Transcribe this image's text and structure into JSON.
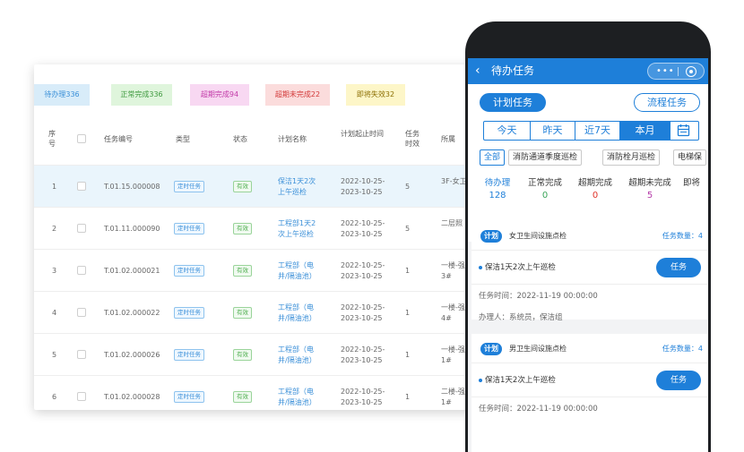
{
  "desktop": {
    "status_pills": [
      {
        "label": "待办理336",
        "bg": "#d8ecf9",
        "color": "#3a8fd8"
      },
      {
        "label": "正常完成336",
        "bg": "#dff5dc",
        "color": "#3f9a3f"
      },
      {
        "label": "超期完成94",
        "bg": "#f8d8f2",
        "color": "#c23aa8"
      },
      {
        "label": "超期未完成22",
        "bg": "#fbdcdc",
        "color": "#d33a3a"
      },
      {
        "label": "即将失效32",
        "bg": "#fdf6c8",
        "color": "#8a6d00"
      }
    ],
    "columns": {
      "index": "序号",
      "task_no": "任务编号",
      "type": "类型",
      "status": "状态",
      "plan_name": "计划名称",
      "plan_period": "计划起止时间",
      "task_validity": "任务时效",
      "belong": "所属"
    },
    "rows": [
      {
        "index": "1",
        "task_no": "T.01.15.000008",
        "type": "定时任务",
        "status": "有效",
        "plan_name_1": "保洁1天2次",
        "plan_name_2": "上午巡检",
        "period_1": "2022-10-25-",
        "period_2": "2023-10-25",
        "validity": "5",
        "belong_1": "3F-女卫",
        "belong_2": ""
      },
      {
        "index": "2",
        "task_no": "T.01.11.000090",
        "type": "定时任务",
        "status": "有效",
        "plan_name_1": "工程部1天2",
        "plan_name_2": "次上午巡检",
        "period_1": "2022-10-25-",
        "period_2": "2023-10-25",
        "validity": "5",
        "belong_1": "二层照",
        "belong_2": ""
      },
      {
        "index": "3",
        "task_no": "T.01.02.000021",
        "type": "定时任务",
        "status": "有效",
        "plan_name_1": "工程部（电",
        "plan_name_2": "井/隔油池）",
        "period_1": "2022-10-25-",
        "period_2": "2023-10-25",
        "validity": "1",
        "belong_1": "一楼-强",
        "belong_2": "3#"
      },
      {
        "index": "4",
        "task_no": "T.01.02.000022",
        "type": "定时任务",
        "status": "有效",
        "plan_name_1": "工程部（电",
        "plan_name_2": "井/隔油池）",
        "period_1": "2022-10-25-",
        "period_2": "2023-10-25",
        "validity": "1",
        "belong_1": "一楼-强",
        "belong_2": "4#"
      },
      {
        "index": "5",
        "task_no": "T.01.02.000026",
        "type": "定时任务",
        "status": "有效",
        "plan_name_1": "工程部（电",
        "plan_name_2": "井/隔油池）",
        "period_1": "2022-10-25-",
        "period_2": "2023-10-25",
        "validity": "1",
        "belong_1": "一楼-强",
        "belong_2": "1#"
      },
      {
        "index": "6",
        "task_no": "T.01.02.000028",
        "type": "定时任务",
        "status": "有效",
        "plan_name_1": "工程部（电",
        "plan_name_2": "井/隔油池）",
        "period_1": "2022-10-25-",
        "period_2": "2023-10-25",
        "validity": "1",
        "belong_1": "二楼-强",
        "belong_2": "1#"
      }
    ]
  },
  "mobile": {
    "title": "待办任务",
    "back_icon": "‹",
    "menu_dots": "•••",
    "segments": [
      "计划任务",
      "流程任务"
    ],
    "date_tabs": [
      "今天",
      "昨天",
      "近7天",
      "本月"
    ],
    "date_selected": "本月",
    "chips": [
      "全部",
      "消防通道季度巡检",
      "消防栓月巡检",
      "电梯保"
    ],
    "stats": [
      {
        "label": "待办理",
        "value": "128",
        "color": "#1e7fd9"
      },
      {
        "label": "正常完成",
        "value": "0",
        "color": "#3aa55a"
      },
      {
        "label": "超期完成",
        "value": "0",
        "color": "#e0352b"
      },
      {
        "label": "超期未完成",
        "value": "5",
        "color": "#b43aa8"
      },
      {
        "label": "即将",
        "value": "",
        "color": "#333333"
      }
    ],
    "cards": [
      {
        "badge": "计划",
        "title": "女卫生间设施点检",
        "count": "任务数量：4",
        "task": "保洁1天2次上午巡检",
        "button": "任务",
        "time": "任务时间：2022-11-19 00:00:00",
        "handler": "办理人：系统员，保洁组"
      },
      {
        "badge": "计划",
        "title": "男卫生间设施点检",
        "count": "任务数量：4",
        "task": "保洁1天2次上午巡检",
        "button": "任务",
        "time": "任务时间：2022-11-19 00:00:00",
        "handler": ""
      }
    ]
  }
}
